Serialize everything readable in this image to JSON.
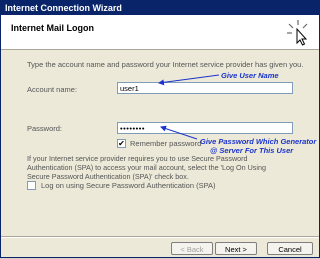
{
  "window": {
    "title": "Internet Connection Wizard"
  },
  "header": {
    "title": "Internet Mail Logon",
    "icon": "wizard-cursor-icon"
  },
  "intro_text": "Type the account name and password your Internet service provider has given you.",
  "account": {
    "label": "Account name:",
    "value": "user1"
  },
  "password": {
    "label": "Password:",
    "value": "••••••••"
  },
  "remember": {
    "label": "Remember password",
    "checked": true,
    "mark": "✔"
  },
  "annotations": {
    "user_name": "Give User Name",
    "password_line1": "Give Password Which Generator",
    "password_line2": "@ Server For This User",
    "color": "#1a33cc"
  },
  "spa_info": "If your Internet service provider requires you to use Secure Password Authentication (SPA) to access your mail account, select the 'Log On Using Secure Password Authentication (SPA)' check box.",
  "spa_checkbox": {
    "label": "Log on using Secure Password Authentication (SPA)",
    "checked": false
  },
  "buttons": {
    "back": "< Back",
    "next": "Next >",
    "cancel": "Cancel"
  }
}
